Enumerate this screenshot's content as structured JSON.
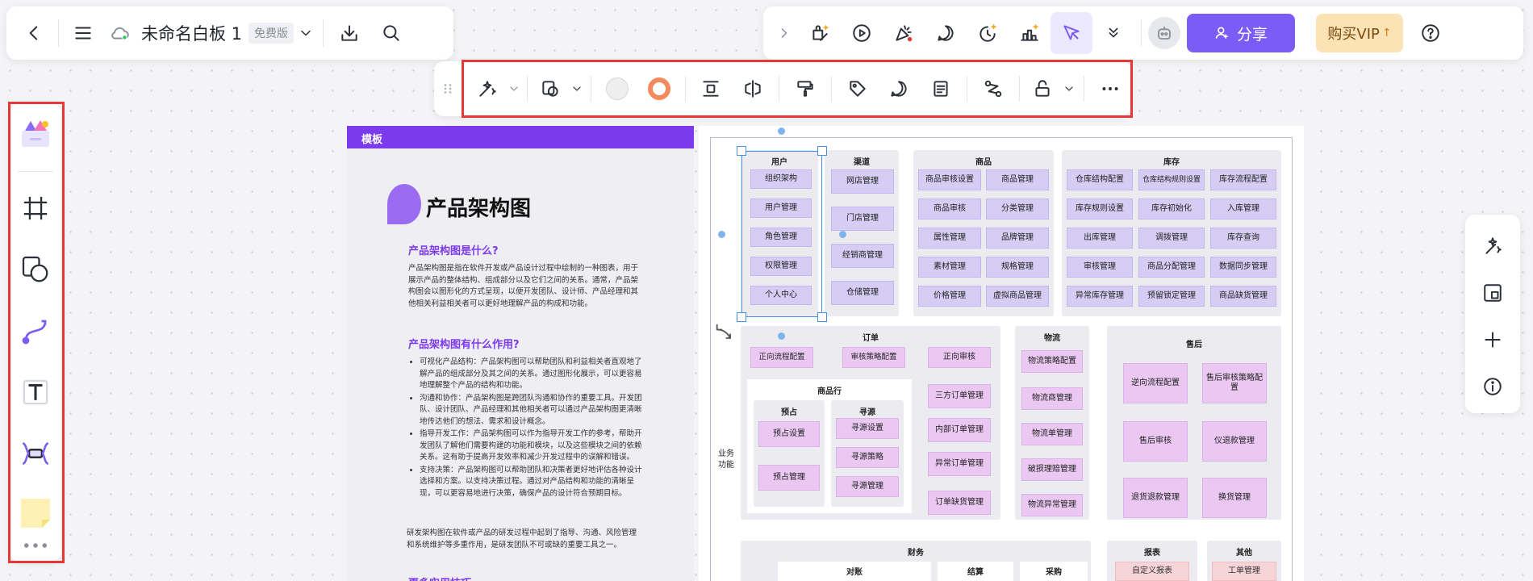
{
  "topbar": {
    "doc_title": "未命名白板 1",
    "plan_badge": "免费版",
    "share_label": "分享",
    "vip_label": "购买VIP"
  },
  "template": {
    "header": "模板",
    "title": "产品架构图",
    "q1": "产品架构图是什么?",
    "p1": "产品架构图是指在软件开发或产品设计过程中绘制的一种图表，用于展示产品的整体结构、组成部分以及它们之间的关系。通常，产品架构图会以图形化的方式呈现，以便开发团队、设计师、产品经理和其他相关利益相关者可以更好地理解产品的构成和功能。",
    "q2": "产品架构图有什么作用?",
    "bullets": [
      "可视化产品结构：产品架构图可以帮助团队和利益相关者直观地了解产品的组成部分及其之间的关系。通过图形化展示，可以更容易地理解整个产品的结构和功能。",
      "沟通和协作：产品架构图是跨团队沟通和协作的重要工具。开发团队、设计团队、产品经理和其他相关者可以通过产品架构图更清晰地传达他们的想法、需求和设计概念。",
      "指导开发工作：产品架构图可以作为指导开发工作的参考，帮助开发团队了解他们需要构建的功能和模块，以及这些模块之间的依赖关系。这有助于提高开发效率和减少开发过程中的误解和错误。",
      "支持决策：产品架构图可以帮助团队和决策者更好地评估各种设计选择和方案。以支持决策过程。通过对产品结构和功能的清晰呈现，可以更容易地进行决策，确保产品的设计符合预期目标。"
    ],
    "p2": "研发架构图在软件或产品的研发过程中起到了指导、沟通、风险管理和系统维护等多重作用，是研发团队不可或缺的重要工具之一。",
    "q3": "更多实用技巧"
  },
  "diagram": {
    "side_label": "业务功能",
    "user": {
      "title": "用户",
      "items": [
        "组织架构",
        "用户管理",
        "角色管理",
        "权限管理",
        "个人中心"
      ]
    },
    "channel": {
      "title": "渠道",
      "items": [
        "网店管理",
        "门店管理",
        "经销商管理",
        "仓储管理"
      ]
    },
    "product": {
      "title": "商品",
      "items": [
        "商品审核设置",
        "商品管理",
        "商品审核",
        "分类管理",
        "属性管理",
        "品牌管理",
        "素材管理",
        "规格管理",
        "价格管理",
        "虚拟商品管理"
      ]
    },
    "inventory": {
      "title": "库存",
      "items": [
        "仓库结构配置",
        "仓库结构规则设置",
        "库存流程配置",
        "库存规则设置",
        "库存初始化",
        "入库管理",
        "出库管理",
        "调拨管理",
        "库存查询",
        "审核管理",
        "商品分配管理",
        "数据同步管理",
        "异常库存管理",
        "预留锁定管理",
        "商品缺货管理"
      ]
    },
    "order": {
      "title": "订单",
      "top": [
        "正向流程配置",
        "审核策略配置",
        "正向审核"
      ],
      "goods_row": "商品行",
      "reserve": {
        "title": "预占",
        "items": [
          "预占设置",
          "预占管理"
        ]
      },
      "source": {
        "title": "寻源",
        "items": [
          "寻源设置",
          "寻源策略",
          "寻源管理"
        ]
      },
      "right": [
        "三方订单管理",
        "内部订单管理",
        "异常订单管理",
        "订单缺货管理"
      ]
    },
    "logistics": {
      "title": "物流",
      "items": [
        "物流策略配置",
        "物流商管理",
        "物流单管理",
        "破损理赔管理",
        "物流异常管理"
      ]
    },
    "aftersale": {
      "title": "售后",
      "items": [
        "逆向流程配置",
        "售后审核策略配置",
        "售后审核",
        "仪退款管理",
        "退货退款管理",
        "换货管理"
      ]
    },
    "finance": {
      "title": "财务",
      "sub": [
        "对账",
        "结算",
        "采购"
      ]
    },
    "report": {
      "title": "报表",
      "items": [
        "自定义报表"
      ]
    },
    "other": {
      "title": "其他",
      "items": [
        "工单管理"
      ]
    }
  }
}
